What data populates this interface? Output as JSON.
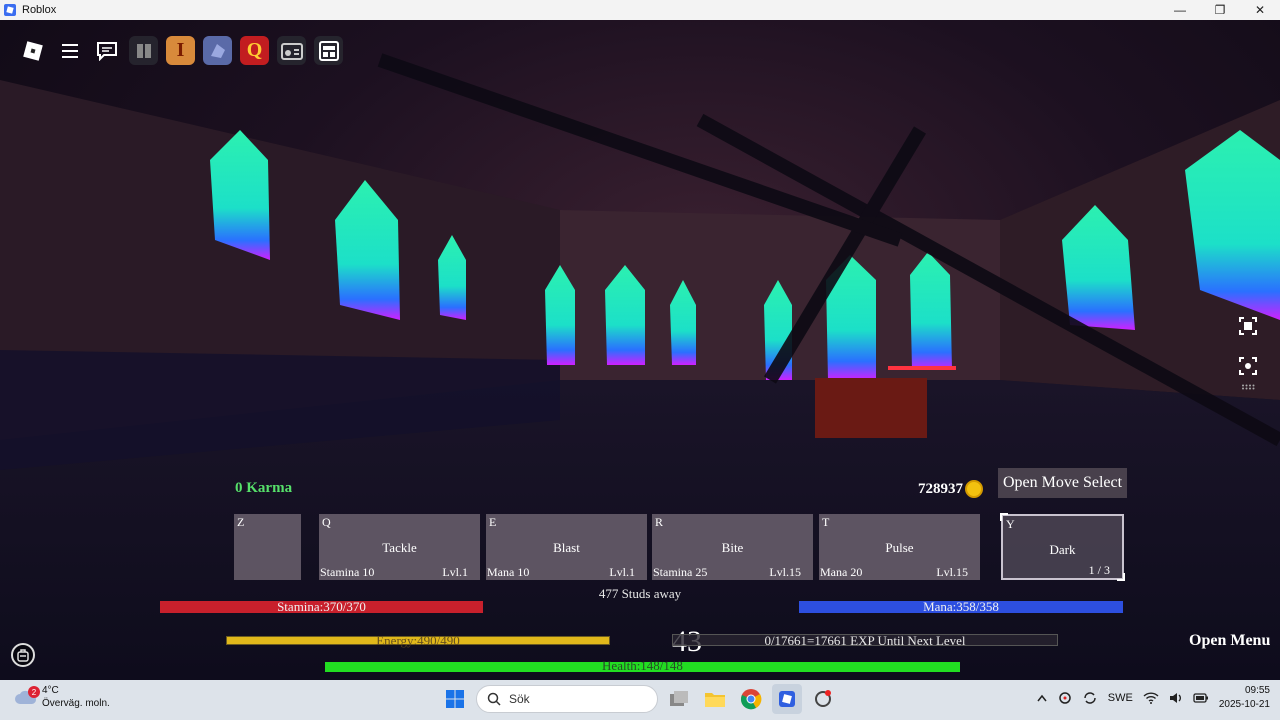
{
  "window": {
    "title": "Roblox",
    "minimize": "—",
    "maximize": "❐",
    "close": "✕"
  },
  "hud": {
    "karma": "0 Karma",
    "coins": "728937",
    "open_move_select": "Open Move Select",
    "slots": [
      {
        "key": "Z",
        "name": "",
        "cost": "",
        "level": ""
      },
      {
        "key": "Q",
        "name": "Tackle",
        "cost": "Stamina 10",
        "level": "Lvl.1"
      },
      {
        "key": "E",
        "name": "Blast",
        "cost": "Mana 10",
        "level": "Lvl.1"
      },
      {
        "key": "R",
        "name": "Bite",
        "cost": "Stamina 25",
        "level": "Lvl.15"
      },
      {
        "key": "T",
        "name": "Pulse",
        "cost": "Mana 20",
        "level": "Lvl.15"
      },
      {
        "key": "Y",
        "name": "Dark",
        "page": "1 / 3"
      }
    ],
    "distance": "477 Studs away",
    "stamina": {
      "label": "Stamina:370/370",
      "fraction": 1.0
    },
    "mana": {
      "label": "Mana:358/358",
      "fraction": 1.0
    },
    "energy": {
      "label": "Energy:490/490",
      "fraction": 1.0
    },
    "health": {
      "label": "Health:148/148",
      "fraction": 1.0
    },
    "level": "43",
    "exp": {
      "label": "0/17661=17661 EXP Until Next Level",
      "fraction": 0
    },
    "open_menu": "Open Menu"
  },
  "taskbar": {
    "weather_badge": "2",
    "temperature": "4°C",
    "weather_desc": "Överväg. moln.",
    "search_placeholder": "Sök",
    "language": "SWE",
    "time": "09:55",
    "date": "2025-10-21"
  },
  "colors": {
    "karma": "#56e06a",
    "stamina": "#c8202c",
    "mana": "#2d4fe0",
    "energy": "#e1b81b",
    "health": "#22dd22",
    "window_glow": "#22f0a0"
  }
}
